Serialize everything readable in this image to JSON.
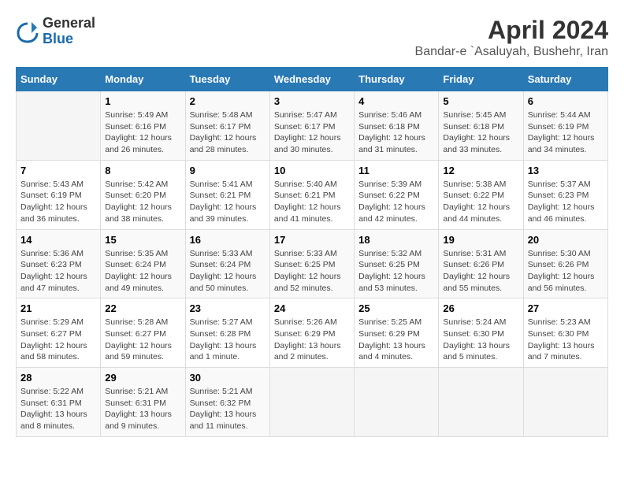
{
  "logo": {
    "general": "General",
    "blue": "Blue"
  },
  "title": "April 2024",
  "subtitle": "Bandar-e `Asaluyah, Bushehr, Iran",
  "days_header": [
    "Sunday",
    "Monday",
    "Tuesday",
    "Wednesday",
    "Thursday",
    "Friday",
    "Saturday"
  ],
  "weeks": [
    [
      {
        "day": "",
        "info": ""
      },
      {
        "day": "1",
        "info": "Sunrise: 5:49 AM\nSunset: 6:16 PM\nDaylight: 12 hours\nand 26 minutes."
      },
      {
        "day": "2",
        "info": "Sunrise: 5:48 AM\nSunset: 6:17 PM\nDaylight: 12 hours\nand 28 minutes."
      },
      {
        "day": "3",
        "info": "Sunrise: 5:47 AM\nSunset: 6:17 PM\nDaylight: 12 hours\nand 30 minutes."
      },
      {
        "day": "4",
        "info": "Sunrise: 5:46 AM\nSunset: 6:18 PM\nDaylight: 12 hours\nand 31 minutes."
      },
      {
        "day": "5",
        "info": "Sunrise: 5:45 AM\nSunset: 6:18 PM\nDaylight: 12 hours\nand 33 minutes."
      },
      {
        "day": "6",
        "info": "Sunrise: 5:44 AM\nSunset: 6:19 PM\nDaylight: 12 hours\nand 34 minutes."
      }
    ],
    [
      {
        "day": "7",
        "info": "Sunrise: 5:43 AM\nSunset: 6:19 PM\nDaylight: 12 hours\nand 36 minutes."
      },
      {
        "day": "8",
        "info": "Sunrise: 5:42 AM\nSunset: 6:20 PM\nDaylight: 12 hours\nand 38 minutes."
      },
      {
        "day": "9",
        "info": "Sunrise: 5:41 AM\nSunset: 6:21 PM\nDaylight: 12 hours\nand 39 minutes."
      },
      {
        "day": "10",
        "info": "Sunrise: 5:40 AM\nSunset: 6:21 PM\nDaylight: 12 hours\nand 41 minutes."
      },
      {
        "day": "11",
        "info": "Sunrise: 5:39 AM\nSunset: 6:22 PM\nDaylight: 12 hours\nand 42 minutes."
      },
      {
        "day": "12",
        "info": "Sunrise: 5:38 AM\nSunset: 6:22 PM\nDaylight: 12 hours\nand 44 minutes."
      },
      {
        "day": "13",
        "info": "Sunrise: 5:37 AM\nSunset: 6:23 PM\nDaylight: 12 hours\nand 46 minutes."
      }
    ],
    [
      {
        "day": "14",
        "info": "Sunrise: 5:36 AM\nSunset: 6:23 PM\nDaylight: 12 hours\nand 47 minutes."
      },
      {
        "day": "15",
        "info": "Sunrise: 5:35 AM\nSunset: 6:24 PM\nDaylight: 12 hours\nand 49 minutes."
      },
      {
        "day": "16",
        "info": "Sunrise: 5:33 AM\nSunset: 6:24 PM\nDaylight: 12 hours\nand 50 minutes."
      },
      {
        "day": "17",
        "info": "Sunrise: 5:33 AM\nSunset: 6:25 PM\nDaylight: 12 hours\nand 52 minutes."
      },
      {
        "day": "18",
        "info": "Sunrise: 5:32 AM\nSunset: 6:25 PM\nDaylight: 12 hours\nand 53 minutes."
      },
      {
        "day": "19",
        "info": "Sunrise: 5:31 AM\nSunset: 6:26 PM\nDaylight: 12 hours\nand 55 minutes."
      },
      {
        "day": "20",
        "info": "Sunrise: 5:30 AM\nSunset: 6:26 PM\nDaylight: 12 hours\nand 56 minutes."
      }
    ],
    [
      {
        "day": "21",
        "info": "Sunrise: 5:29 AM\nSunset: 6:27 PM\nDaylight: 12 hours\nand 58 minutes."
      },
      {
        "day": "22",
        "info": "Sunrise: 5:28 AM\nSunset: 6:27 PM\nDaylight: 12 hours\nand 59 minutes."
      },
      {
        "day": "23",
        "info": "Sunrise: 5:27 AM\nSunset: 6:28 PM\nDaylight: 13 hours\nand 1 minute."
      },
      {
        "day": "24",
        "info": "Sunrise: 5:26 AM\nSunset: 6:29 PM\nDaylight: 13 hours\nand 2 minutes."
      },
      {
        "day": "25",
        "info": "Sunrise: 5:25 AM\nSunset: 6:29 PM\nDaylight: 13 hours\nand 4 minutes."
      },
      {
        "day": "26",
        "info": "Sunrise: 5:24 AM\nSunset: 6:30 PM\nDaylight: 13 hours\nand 5 minutes."
      },
      {
        "day": "27",
        "info": "Sunrise: 5:23 AM\nSunset: 6:30 PM\nDaylight: 13 hours\nand 7 minutes."
      }
    ],
    [
      {
        "day": "28",
        "info": "Sunrise: 5:22 AM\nSunset: 6:31 PM\nDaylight: 13 hours\nand 8 minutes."
      },
      {
        "day": "29",
        "info": "Sunrise: 5:21 AM\nSunset: 6:31 PM\nDaylight: 13 hours\nand 9 minutes."
      },
      {
        "day": "30",
        "info": "Sunrise: 5:21 AM\nSunset: 6:32 PM\nDaylight: 13 hours\nand 11 minutes."
      },
      {
        "day": "",
        "info": ""
      },
      {
        "day": "",
        "info": ""
      },
      {
        "day": "",
        "info": ""
      },
      {
        "day": "",
        "info": ""
      }
    ]
  ]
}
